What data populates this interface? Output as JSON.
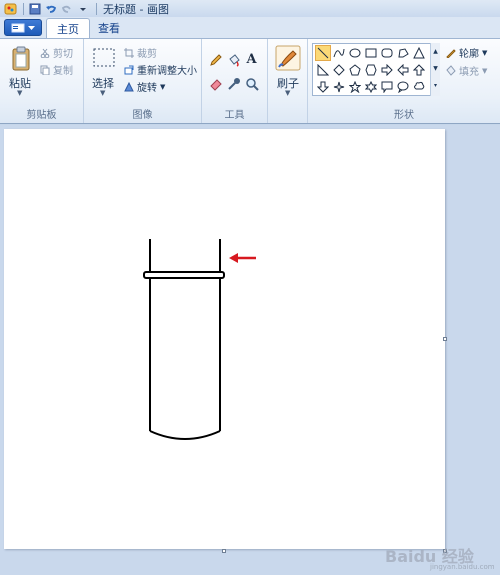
{
  "window": {
    "title": "无标题 - 画图"
  },
  "tabs": [
    {
      "label": "主页"
    },
    {
      "label": "查看"
    }
  ],
  "ribbon": {
    "clipboard": {
      "paste": "粘贴",
      "cut": "剪切",
      "copy": "复制",
      "label": "剪贴板"
    },
    "image": {
      "select": "选择",
      "crop": "裁剪",
      "resize": "重新调整大小",
      "rotate": "旋转",
      "label": "图像"
    },
    "tools": {
      "label": "工具",
      "text_glyph": "A"
    },
    "brushes": {
      "label": "刷子"
    },
    "shapes": {
      "label": "形状",
      "outline": "轮廓",
      "fill": "填充"
    }
  },
  "colors": {
    "arrow": "#d71920",
    "drawing": "#000000",
    "accent": "#1e5bb8"
  },
  "watermark": {
    "brand": "Baidu 经验",
    "sub": "jingyan.baidu.com"
  }
}
